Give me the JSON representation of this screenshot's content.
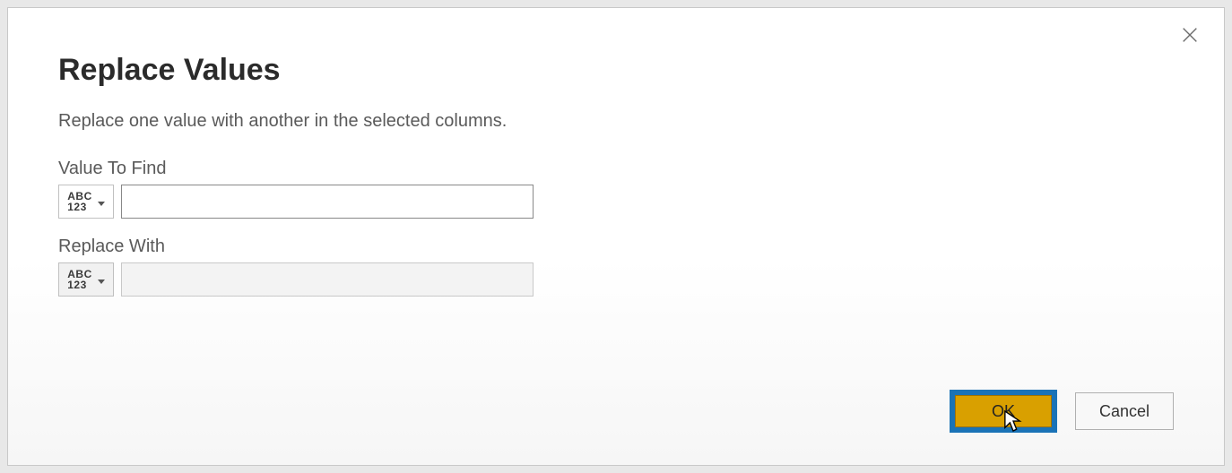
{
  "dialog": {
    "title": "Replace Values",
    "subtitle": "Replace one value with another in the selected columns."
  },
  "fields": {
    "find": {
      "label": "Value To Find",
      "type_line1": "ABC",
      "type_line2": "123",
      "value": ""
    },
    "replace": {
      "label": "Replace With",
      "type_line1": "ABC",
      "type_line2": "123",
      "value": ""
    }
  },
  "buttons": {
    "ok": "OK",
    "cancel": "Cancel"
  }
}
